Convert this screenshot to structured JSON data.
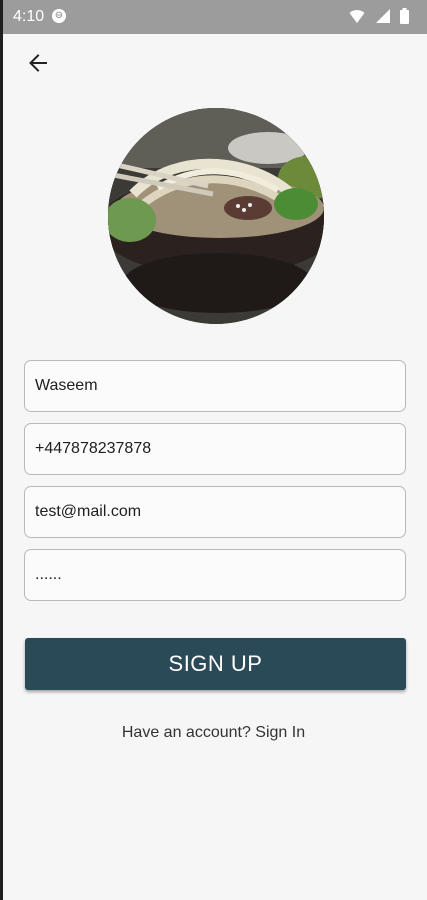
{
  "status_bar": {
    "time": "4:10",
    "badge_glyph": "⊖"
  },
  "icons": {
    "back": "arrow-left-icon",
    "wifi": "wifi-icon",
    "signal": "cell-signal-icon",
    "battery": "battery-icon"
  },
  "form": {
    "name_value": "Waseem",
    "phone_value": "+447878237878",
    "email_value": "test@mail.com",
    "password_value": "......"
  },
  "actions": {
    "signup_label": "SIGN UP",
    "signin_text": "Have an account? Sign In"
  },
  "colors": {
    "primary_button": "#2a4a58",
    "status_bar": "#9c9c9c"
  }
}
